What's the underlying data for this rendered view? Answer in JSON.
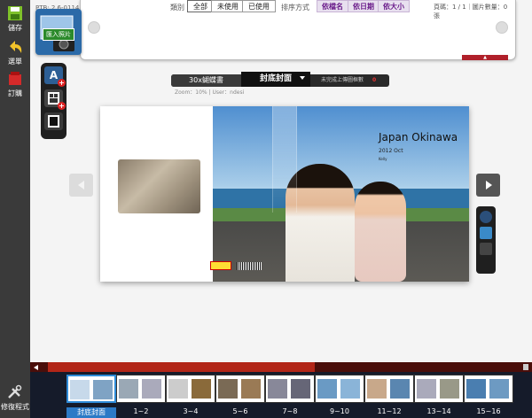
{
  "app": {
    "version": "PTB: 2.6-0114"
  },
  "sidebar": {
    "save": "儲存",
    "menu": "選單",
    "order": "訂購",
    "tools": "修復程式"
  },
  "filter": {
    "label": "類別",
    "tabs": [
      "全部",
      "未使用",
      "已使用"
    ],
    "selected": "全部"
  },
  "sort": {
    "label": "排序方式",
    "options": [
      "依檔名",
      "依日期",
      "依大小"
    ]
  },
  "pager": {
    "info": "頁碼：1 / 1｜圖片數量：0 張"
  },
  "import_button": {
    "label": "匯入照片"
  },
  "tools": {
    "text_icon": "A"
  },
  "mode_bar": {
    "size": "30x蝴蝶書",
    "current": "封底封面",
    "status": "未完成上傳圖框數",
    "count": "0"
  },
  "zoom_info": "Zoom：10%  |  User：ndesi",
  "cover": {
    "title": "Japan Okinawa",
    "date": "2012 Oct",
    "author": "Kelly"
  },
  "thumbnails": [
    {
      "label": "封底封面",
      "active": true
    },
    {
      "label": "1~2"
    },
    {
      "label": "3~4"
    },
    {
      "label": "5~6"
    },
    {
      "label": "7~8"
    },
    {
      "label": "9~10"
    },
    {
      "label": "11~12"
    },
    {
      "label": "13~14"
    },
    {
      "label": "15~16"
    }
  ],
  "colors": {
    "accent_red": "#b22618",
    "sort_purple": "#6a1b8a",
    "sidebar_bg": "#3a3a3a"
  }
}
